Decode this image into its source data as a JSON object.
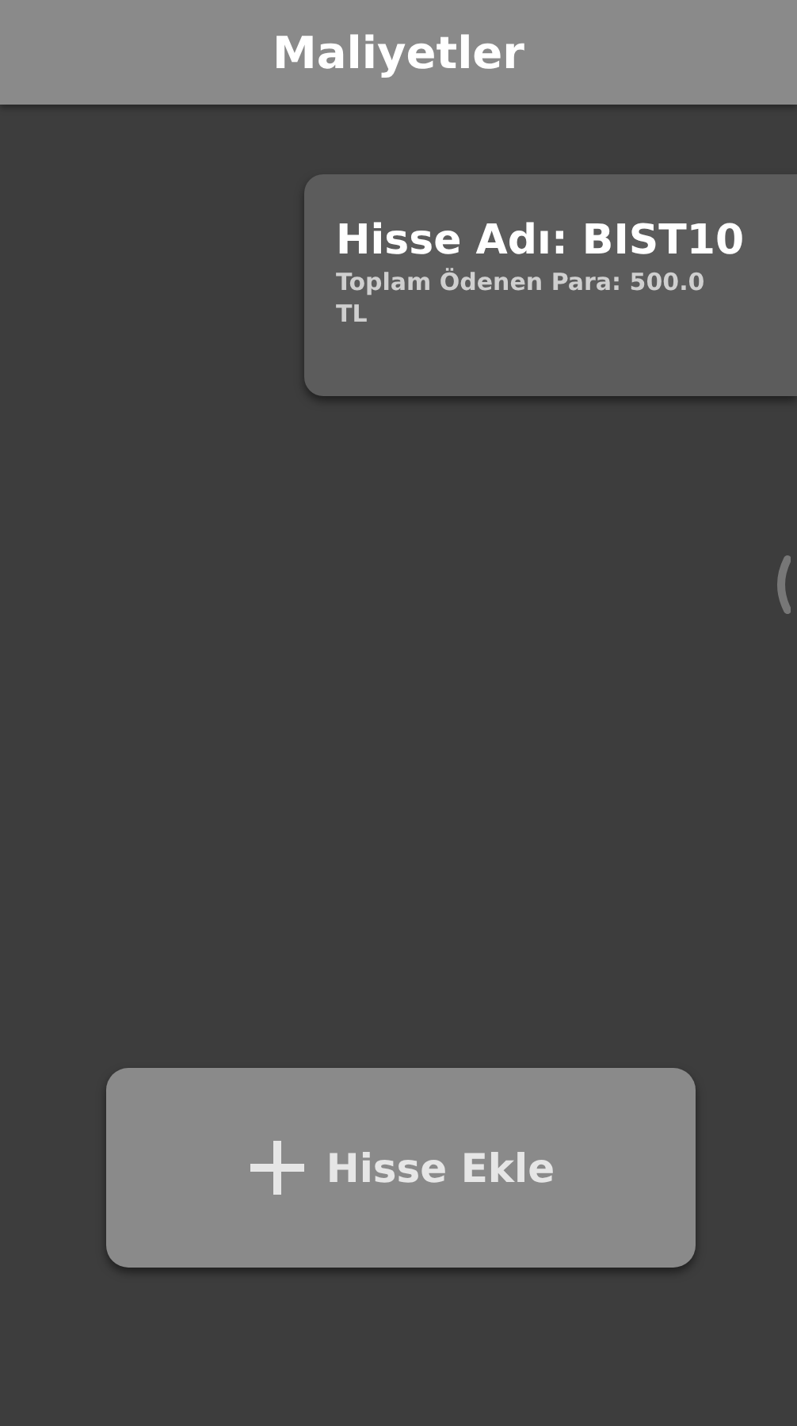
{
  "header": {
    "title": "Maliyetler"
  },
  "cards": [
    {
      "name": "Hisse Adı: BIST10",
      "total_line": "Toplam Ödenen Para: 500.0",
      "total_line_2": "TL"
    }
  ],
  "add_button": {
    "label": "Hisse Ekle"
  }
}
